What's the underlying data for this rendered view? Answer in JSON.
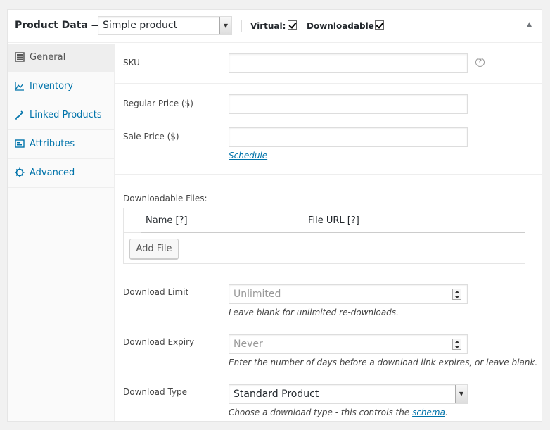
{
  "header": {
    "title": "Product Data —",
    "product_type": "Simple product",
    "virtual_label": "Virtual:",
    "virtual_checked": true,
    "downloadable_label": "Downloadable:",
    "downloadable_checked": true
  },
  "tabs": [
    {
      "label": "General",
      "icon": "general-icon",
      "active": true
    },
    {
      "label": "Inventory",
      "icon": "inventory-icon",
      "active": false
    },
    {
      "label": "Linked Products",
      "icon": "link-icon",
      "active": false
    },
    {
      "label": "Attributes",
      "icon": "attributes-icon",
      "active": false
    },
    {
      "label": "Advanced",
      "icon": "gear-icon",
      "active": false
    }
  ],
  "fields": {
    "sku_label": "SKU",
    "sku_value": "",
    "regular_price_label": "Regular Price ($)",
    "regular_price_value": "",
    "sale_price_label": "Sale Price ($)",
    "sale_price_value": "",
    "schedule_link": "Schedule",
    "downloadable_files_label": "Downloadable Files:",
    "files_columns": [
      "Name [?]",
      "File URL [?]"
    ],
    "add_file_button": "Add File",
    "download_limit_label": "Download Limit",
    "download_limit_placeholder": "Unlimited",
    "download_limit_desc": "Leave blank for unlimited re-downloads.",
    "download_expiry_label": "Download Expiry",
    "download_expiry_placeholder": "Never",
    "download_expiry_desc": "Enter the number of days before a download link expires, or leave blank.",
    "download_type_label": "Download Type",
    "download_type_value": "Standard Product",
    "download_type_desc": "Choose a download type - this controls the",
    "download_type_link": "schema",
    "download_type_desc_end": "."
  }
}
